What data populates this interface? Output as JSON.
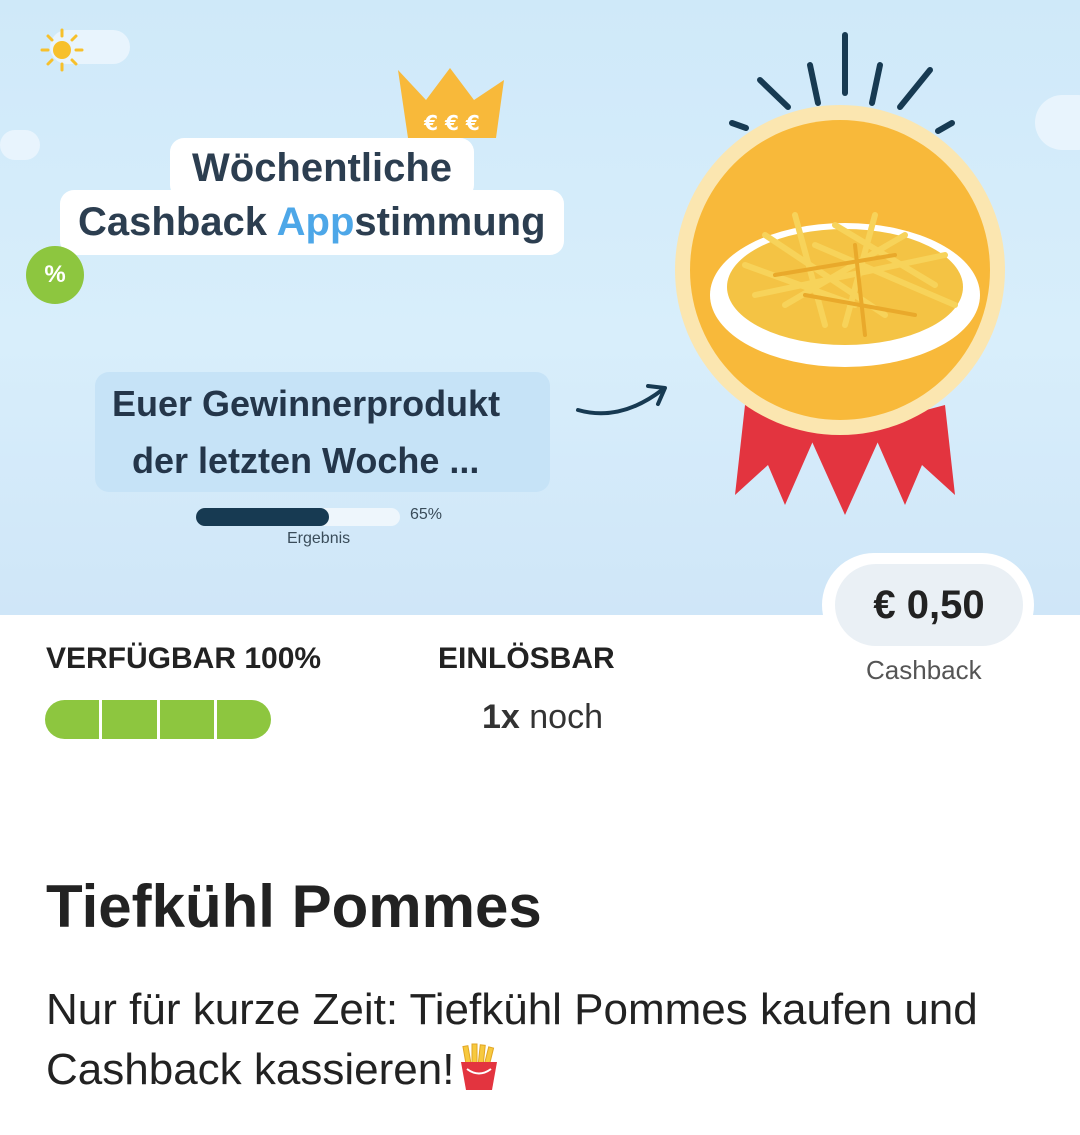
{
  "banner": {
    "headline_line1": "Wöchentliche",
    "headline_line2_pre": "Cashback ",
    "headline_line2_accent": "App",
    "headline_line2_post": "stimmung",
    "crown_text": "€ € €",
    "percent_badge": "%",
    "winner_line1": "Euer Gewinnerprodukt",
    "winner_line2": "der letzten Woche ...",
    "progress_percent": "65%",
    "progress_fill": 0.65,
    "progress_caption": "Ergebnis"
  },
  "price": {
    "amount": "€ 0,50",
    "caption": "Cashback"
  },
  "availability": {
    "label": "VERFÜGBAR 100%",
    "fill_fraction": 1.0,
    "segments": 4
  },
  "redeemable": {
    "label": "EINLÖSBAR",
    "count": "1x",
    "suffix": " noch"
  },
  "product": {
    "title": "Tiefkühl Pommes",
    "description": "Nur für kurze Zeit: Tiefkühl Pommes kaufen und Cashback kassieren!"
  },
  "colors": {
    "accent_blue": "#4da7e8",
    "green": "#8dc63f",
    "medal_orange": "#f8b93a",
    "ribbon_red": "#e3343f"
  },
  "icons": [
    "sun-icon",
    "crown-icon",
    "percent-badge-icon",
    "arrow-icon",
    "medal-icon",
    "fries-icon"
  ]
}
